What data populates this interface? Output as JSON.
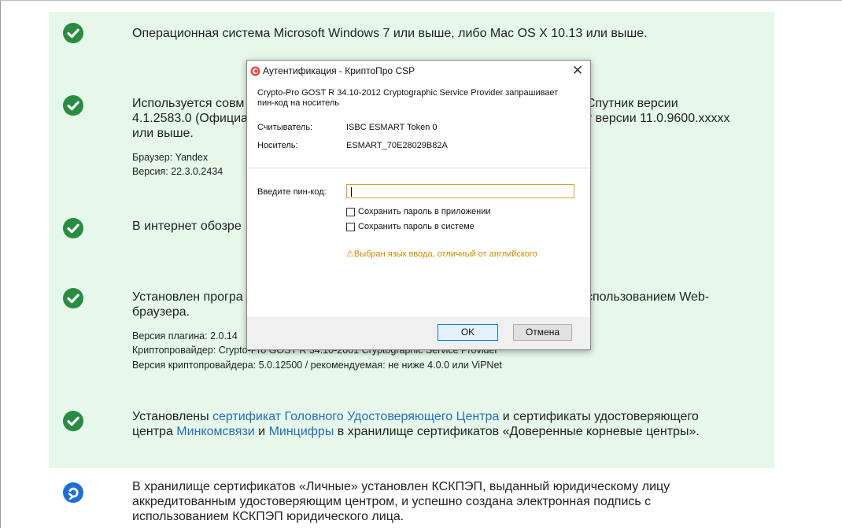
{
  "requirements": [
    {
      "status": "ok",
      "lines": [
        "Операционная система Microsoft Windows 7 или выше, либо Mac OS X 10.13 или выше."
      ]
    },
    {
      "status": "ok",
      "lines": [
        "Используется совм",
        "4.1.2583.0 (Официа",
        "или выше."
      ],
      "lines_right": [
        "; Спутник версии",
        "er версии 11.0.9600.xxxxx"
      ],
      "details": [
        "Браузер: Yandex",
        "Версия: 22.3.0.2434"
      ]
    },
    {
      "status": "ok",
      "lines": [
        "В интернет обозре"
      ]
    },
    {
      "status": "ok",
      "lines": [
        "Установлен програ",
        "браузера."
      ],
      "lines_right": [
        "использованием Web-"
      ],
      "details": [
        "Версия плагина: 2.0.14",
        "Криптопровайдер: Crypto-Pro GOST R 34.10-2001 Cryptographic Service Provider",
        "Версия криптопровайдера: 5.0.12500 / рекомендуемая: не ниже 4.0.0 или ViPNet"
      ]
    },
    {
      "status": "ok",
      "line1": {
        "t1": "Установлены ",
        "link1": "сертификат Головного Удостоверяющего Центра",
        "t2": " и сертификаты удостоверяющего"
      },
      "line2": {
        "t1": "центра ",
        "link1": "Минкомсвязи",
        "t2": " и ",
        "link2": "Минцифры",
        "t3": " в хранилище сертификатов «Доверенные корневые центры»."
      }
    },
    {
      "status": "pending",
      "lines": [
        "В хранилище сертификатов «Личные» установлен КСКПЭП, выданный юридическому лицу",
        "аккредитованным удостоверяющим центром, и успешно создана электронная подпись с",
        "использованием КСКПЭП юридического лица."
      ]
    }
  ],
  "dialog": {
    "title": "Аутентификация - КриптоПро CSP",
    "close_glyph": "✕",
    "message_line1": "Crypto-Pro GOST R 34.10-2012 Cryptographic Service Provider запрашивает",
    "message_line2": "пин-код на носитель",
    "reader_label": "Считыватель:",
    "reader_value": "ISBC ESMART Token 0",
    "carrier_label": "Носитель:",
    "carrier_value": "ESMART_70E28029B82A",
    "pin_label": "Введите пин-код:",
    "pin_value": "",
    "save_in_app_label": "Сохранить пароль в приложении",
    "save_in_system_label": "Сохранить пароль в системе",
    "warning_icon": "⚠",
    "warning_text": "Выбран язык ввода, отличный от английского",
    "ok_label": "OK",
    "cancel_label": "Отмена"
  },
  "colors": {
    "panel_bg": "#e6f8e9",
    "check": "#2a8c43",
    "pending": "#1f6fd2",
    "link": "#2a6db8",
    "warning": "#cc8a00",
    "accent": "#0078d7"
  }
}
